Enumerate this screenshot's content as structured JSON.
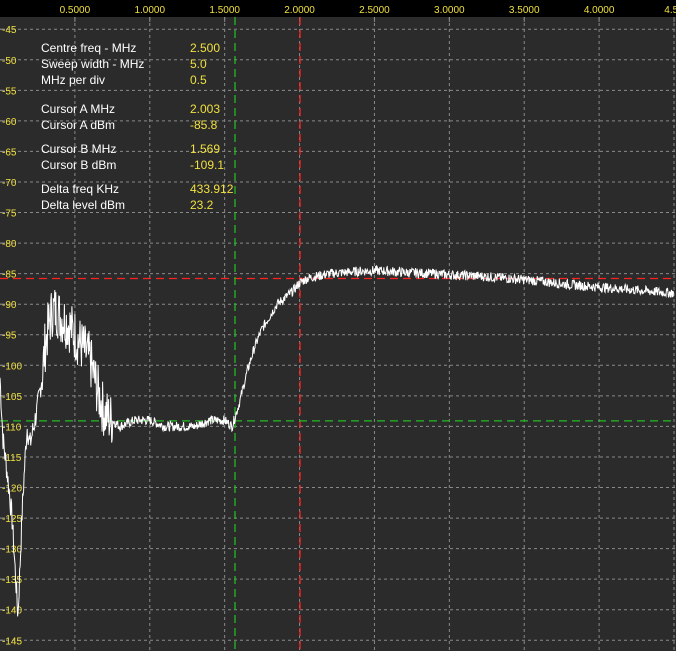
{
  "colors": {
    "background": "#000000",
    "plot_background": "#2b2b2b",
    "grid": "#8a8a8a",
    "tick_text": "#f0e040",
    "label_text": "#ffffff",
    "value_text": "#f0e040",
    "trace": "#ffffff",
    "cursor_a": "#ff2020",
    "cursor_b": "#22bb22"
  },
  "readouts": [
    {
      "label": "Centre freq - MHz",
      "value": "2.500"
    },
    {
      "label": "Sweep width - MHz",
      "value": "5.0"
    },
    {
      "label": "MHz per div",
      "value": "0.5"
    },
    {
      "label": "Cursor A MHz",
      "value": "2.003"
    },
    {
      "label": "Cursor A dBm",
      "value": "-85.8"
    },
    {
      "label": "Cursor B MHz",
      "value": "1.569"
    },
    {
      "label": "Cursor B dBm",
      "value": "-109.1"
    },
    {
      "label": "Delta freq KHz",
      "value": "433.912"
    },
    {
      "label": "Delta level dBm",
      "value": "23.2"
    }
  ],
  "chart_data": {
    "type": "line",
    "title": "",
    "xlabel": "",
    "ylabel": "",
    "xlim": [
      0.0,
      4.5
    ],
    "ylim": [
      -148,
      -43
    ],
    "grid": true,
    "x_ticks": [
      "0.5000",
      "1.0000",
      "1.5000",
      "2.0000",
      "2.5000",
      "3.0000",
      "3.5000",
      "4.0000",
      "4.50"
    ],
    "y_ticks": [
      "-45",
      "-50",
      "-55",
      "-60",
      "-65",
      "-70",
      "-75",
      "-80",
      "-85",
      "-90",
      "-95",
      "-100",
      "-105",
      "-110",
      "-115",
      "-120",
      "-125",
      "-130",
      "-135",
      "-140",
      "-145"
    ],
    "cursors": [
      {
        "name": "Cursor A",
        "x": 2.003,
        "y": -85.8
      },
      {
        "name": "Cursor B",
        "x": 1.569,
        "y": -109.1
      }
    ],
    "series": [
      {
        "x": [
          0.0,
          0.02,
          0.05,
          0.08,
          0.1,
          0.12,
          0.15,
          0.18,
          0.2,
          0.25,
          0.28,
          0.3,
          0.32,
          0.35,
          0.38,
          0.4,
          0.45,
          0.5,
          0.55,
          0.6,
          0.65,
          0.7,
          0.75,
          0.8,
          0.9,
          1.0,
          1.1,
          1.2,
          1.3,
          1.4,
          1.5,
          1.55,
          1.6,
          1.65,
          1.7,
          1.75,
          1.8,
          1.85,
          1.9,
          1.95,
          2.0,
          2.05,
          2.1,
          2.2,
          2.3,
          2.4,
          2.5,
          2.6,
          2.7,
          2.8,
          2.9,
          3.0,
          3.1,
          3.2,
          3.3,
          3.4,
          3.5,
          3.6,
          3.7,
          3.8,
          3.9,
          4.0,
          4.1,
          4.2,
          4.3,
          4.4,
          4.5
        ],
        "y": [
          -102,
          -112,
          -118,
          -125,
          -133,
          -141,
          -123,
          -110,
          -113,
          -107,
          -102,
          -97,
          -94,
          -91,
          -91,
          -92,
          -93,
          -95,
          -97,
          -99,
          -104,
          -108,
          -109,
          -110,
          -109,
          -109,
          -110,
          -110,
          -110,
          -109,
          -109,
          -110,
          -106,
          -101,
          -97,
          -94,
          -92,
          -90,
          -89,
          -88,
          -86.5,
          -85.8,
          -85.5,
          -85,
          -84.8,
          -84.6,
          -84.5,
          -84.6,
          -84.8,
          -84.9,
          -85,
          -85.2,
          -85.3,
          -85.4,
          -85.6,
          -85.8,
          -86,
          -86.2,
          -86.5,
          -86.8,
          -87,
          -87.2,
          -87.4,
          -87.6,
          -87.8,
          -88,
          -88.2
        ]
      }
    ]
  }
}
